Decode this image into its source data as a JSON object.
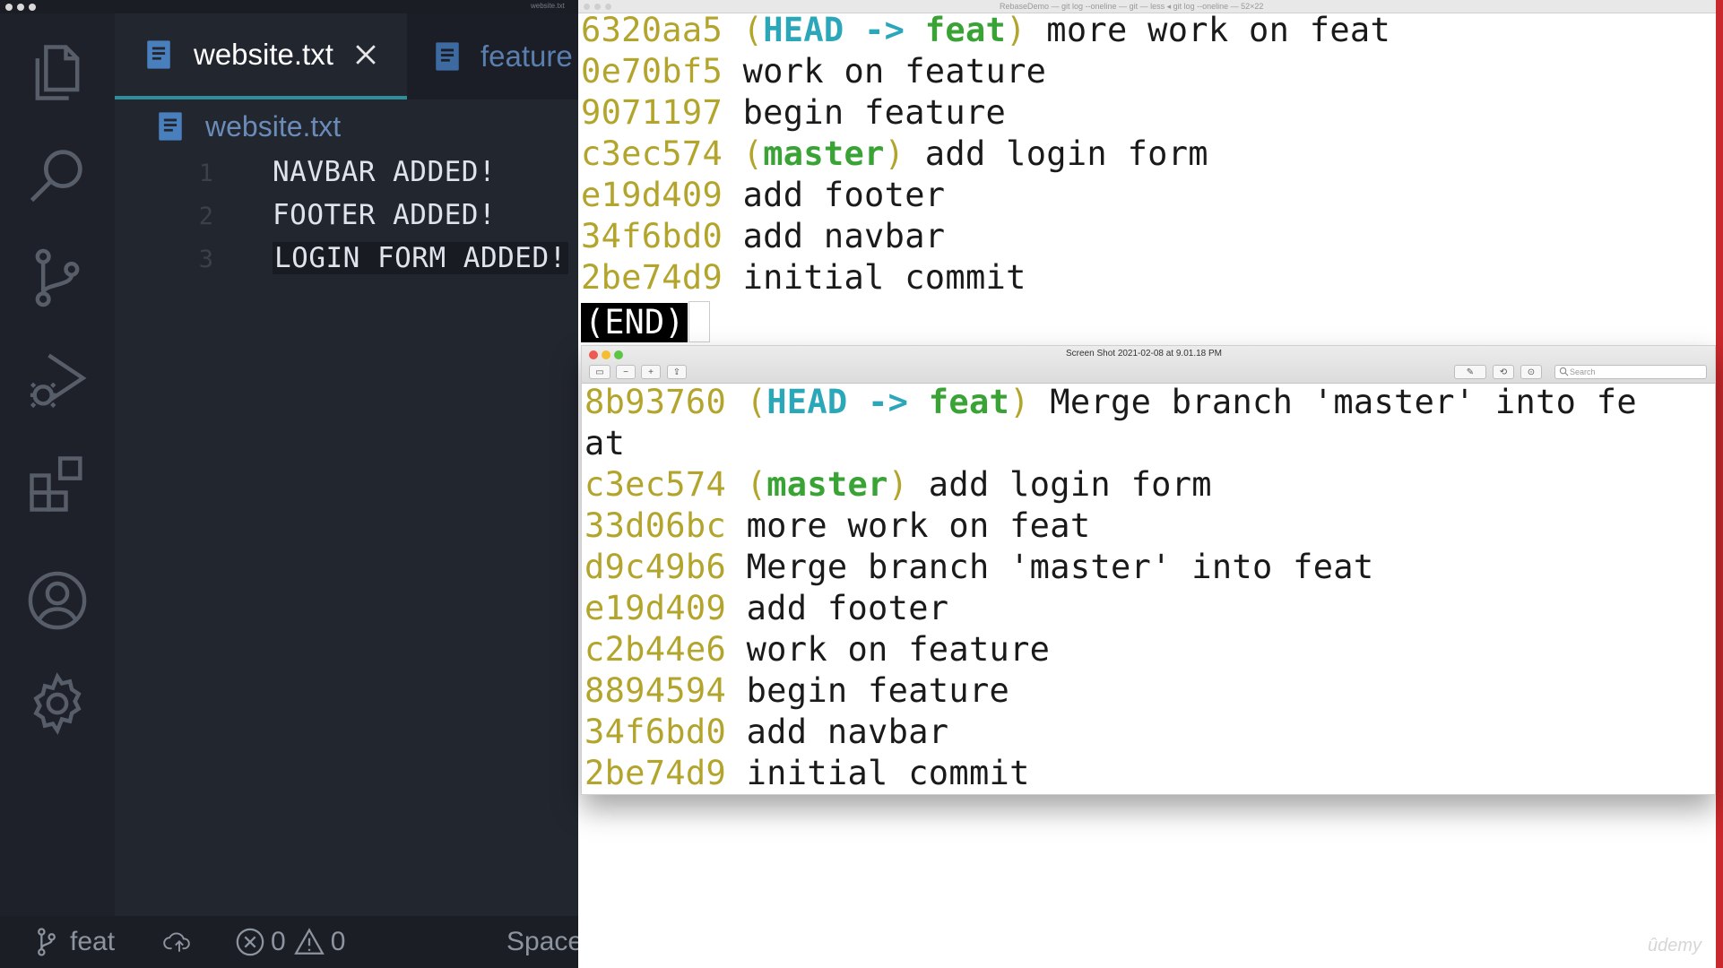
{
  "vscode": {
    "titlebar_text": "website.txt",
    "tabs": [
      {
        "label": "website.txt",
        "active": true
      },
      {
        "label": "feature"
      }
    ],
    "breadcrumb": "website.txt",
    "lines": [
      {
        "num": "1",
        "text": "NAVBAR ADDED!"
      },
      {
        "num": "2",
        "text": "FOOTER ADDED!"
      },
      {
        "num": "3",
        "text": "LOGIN FORM ADDED!"
      }
    ],
    "activity_icons": [
      "files-icon",
      "search-icon",
      "source-control-icon",
      "run-debug-icon",
      "extensions-icon",
      "account-icon",
      "settings-gear-icon"
    ],
    "status": {
      "branch": "feat",
      "errors": "0",
      "warnings": "0",
      "spaces": "Spaces"
    }
  },
  "terminal": {
    "title": "RebaseDemo — git log --oneline — git — less ◂ git log --oneline — 52×22",
    "lines": [
      {
        "hash": "6320aa5",
        "ref_open": " (",
        "head": "HEAD -> ",
        "branch": "feat",
        "ref_close": ")",
        "msg": " more work on feat"
      },
      {
        "hash": "0e70bf5",
        "msg": " work on feature"
      },
      {
        "hash": "9071197",
        "msg": " begin feature"
      },
      {
        "hash": "c3ec574",
        "ref_open": " (",
        "branch": "master",
        "ref_close": ")",
        "msg": " add login form"
      },
      {
        "hash": "e19d409",
        "msg": " add footer"
      },
      {
        "hash": "34f6bd0",
        "msg": " add navbar"
      },
      {
        "hash": "2be74d9",
        "msg": " initial commit"
      }
    ],
    "end": "(END)"
  },
  "preview": {
    "title": "Screen Shot 2021-02-08 at 9.01.18 PM",
    "search_placeholder": "Search",
    "lines": [
      {
        "hash": "8b93760",
        "ref_open": " (",
        "head": "HEAD -> ",
        "branch": "feat",
        "ref_close": ")",
        "msg": " Merge branch 'master' into fe"
      },
      {
        "hash": "",
        "msg": "at"
      },
      {
        "hash": "c3ec574",
        "ref_open": " (",
        "branch": "master",
        "ref_close": ")",
        "msg": " add login form"
      },
      {
        "hash": "33d06bc",
        "msg": " more work on feat"
      },
      {
        "hash": "d9c49b6",
        "msg": " Merge branch 'master' into feat"
      },
      {
        "hash": "e19d409",
        "msg": " add footer"
      },
      {
        "hash": "c2b44e6",
        "msg": " work on feature"
      },
      {
        "hash": "8894594",
        "msg": " begin feature"
      },
      {
        "hash": "34f6bd0",
        "msg": " add navbar"
      },
      {
        "hash": "2be74d9",
        "msg": " initial commit"
      }
    ]
  },
  "watermark": "ûdemy",
  "colors": {
    "hash": "#b3a42c",
    "head": "#2aa7b8",
    "branch": "#3aa335",
    "accent": "#2e8e9a"
  }
}
